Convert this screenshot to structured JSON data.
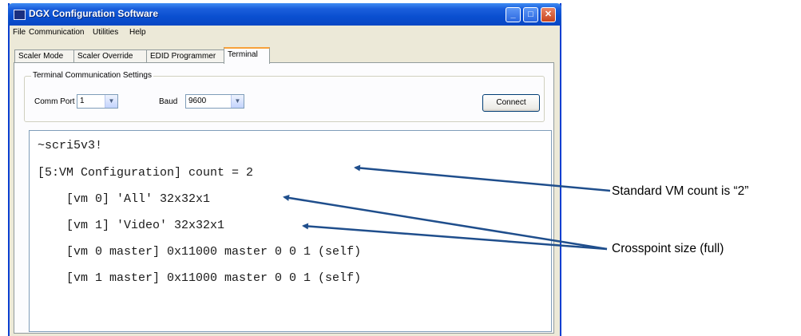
{
  "window": {
    "title": "DGX Configuration Software",
    "min_glyph": "_",
    "max_glyph": "□",
    "close_glyph": "✕"
  },
  "menu": [
    "File",
    "Communication",
    "Utilities",
    "Help"
  ],
  "tabs": [
    {
      "label": "Scaler Mode",
      "active": false
    },
    {
      "label": "Scaler Override",
      "active": false
    },
    {
      "label": "EDID Programmer",
      "active": false
    },
    {
      "label": "Terminal",
      "active": true
    }
  ],
  "settings": {
    "legend": "Terminal Communication Settings",
    "comm_port_label": "Comm Port",
    "comm_port_value": "1",
    "baud_label": "Baud",
    "baud_value": "9600",
    "connect_label": "Connect"
  },
  "terminal": {
    "lines": [
      "~scri5v3!",
      "[5:VM Configuration] count = 2",
      "    [vm 0] 'All' 32x32x1",
      "    [vm 1] 'Video' 32x32x1",
      "    [vm 0 master] 0x11000 master 0 0 1 (self)",
      "    [vm 1 master] 0x11000 master 0 0 1 (self)"
    ]
  },
  "annotations": {
    "vm_count": "Standard VM count is “2”",
    "crosspoint": "Crosspoint size (full)",
    "arrow_color": "#1f4e8c"
  },
  "colors": {
    "titlebar": "#0a4fd0",
    "window_bg": "#ece9d8",
    "tab_highlight": "#f7a13a"
  }
}
